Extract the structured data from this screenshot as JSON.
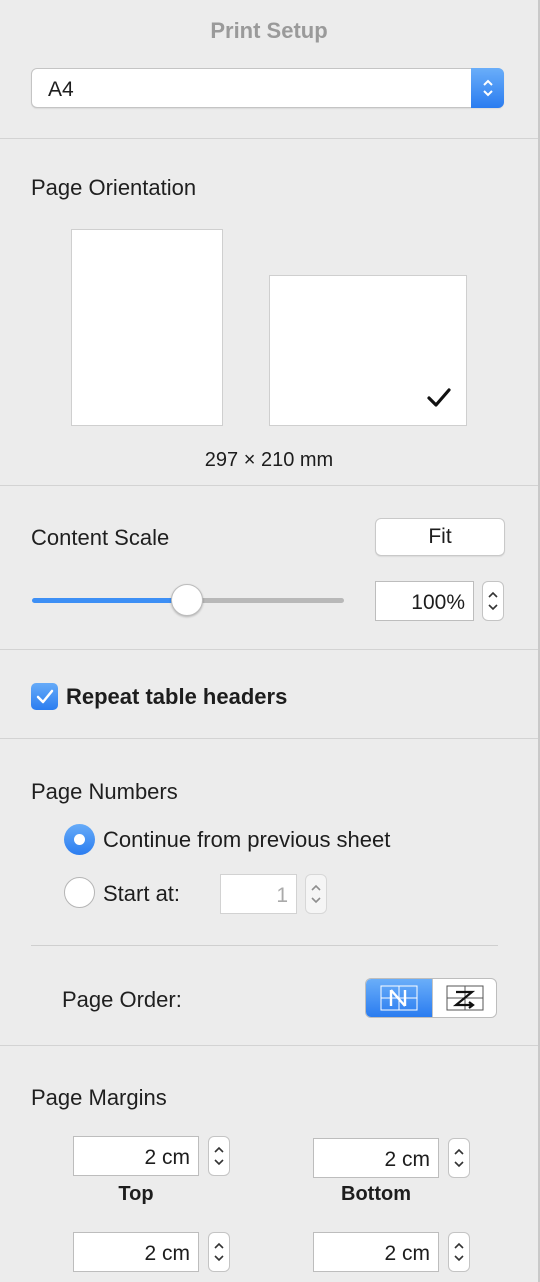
{
  "panel": {
    "title": "Print Setup"
  },
  "paper": {
    "selected": "A4"
  },
  "orientation": {
    "heading": "Page Orientation",
    "selected": "landscape",
    "dimensions": "297 × 210 mm"
  },
  "scale": {
    "heading": "Content Scale",
    "fit_label": "Fit",
    "value": "100%",
    "slider_level": 0.5
  },
  "repeat_headers": {
    "label": "Repeat table headers",
    "checked": true
  },
  "page_numbers": {
    "heading": "Page Numbers",
    "option_continue": "Continue from previous sheet",
    "option_start": "Start at:",
    "start_value": "1",
    "selected": "continue"
  },
  "page_order": {
    "label": "Page Order:",
    "selected": "down-then-over"
  },
  "margins": {
    "heading": "Page Margins",
    "top": {
      "label": "Top",
      "value": "2 cm"
    },
    "bottom": {
      "label": "Bottom",
      "value": "2 cm"
    },
    "left": {
      "value": "2 cm"
    },
    "right": {
      "value": "2 cm"
    }
  },
  "colors": {
    "accent": "#2b7df0",
    "background": "#ececec"
  }
}
